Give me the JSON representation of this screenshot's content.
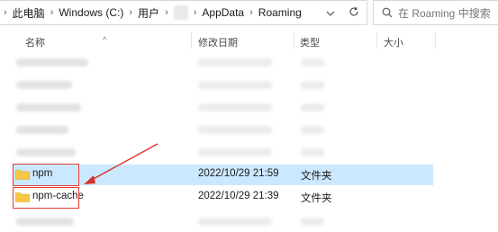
{
  "address_bar": {
    "crumbs": [
      "此电脑",
      "Windows (C:)",
      "用户",
      "AppData",
      "Roaming"
    ]
  },
  "search": {
    "placeholder": "在 Roaming 中搜索"
  },
  "columns": {
    "name": "名称",
    "modified": "修改日期",
    "type": "类型",
    "size": "大小"
  },
  "rows": [
    {
      "name": "npm",
      "modified": "2022/10/29 21:59",
      "type": "文件夹",
      "selected": true
    },
    {
      "name": "npm-cache",
      "modified": "2022/10/29 21:39",
      "type": "文件夹",
      "selected": false
    }
  ],
  "colors": {
    "selection": "#cce8ff",
    "highlight": "#e53935",
    "folder": "#f6c744"
  },
  "icons": [
    "chevron-right-icon",
    "chevron-down-icon",
    "refresh-icon",
    "search-icon",
    "folder-icon",
    "annotation-arrow"
  ]
}
